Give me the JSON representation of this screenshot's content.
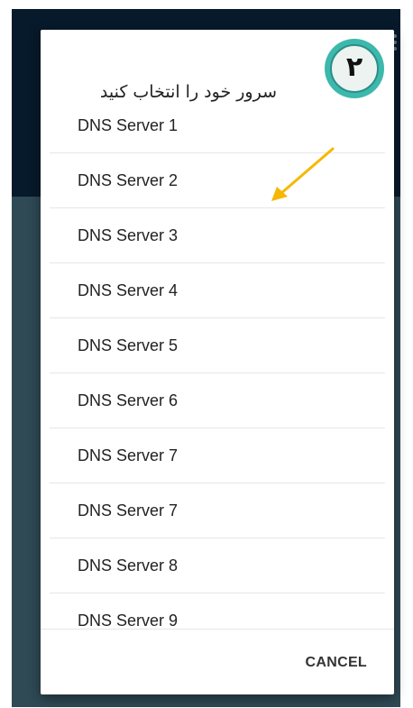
{
  "dialog": {
    "title": "سرور خود را انتخاب کنید",
    "step_badge": "٢",
    "cancel_label": "CANCEL"
  },
  "servers": [
    "DNS Server 1",
    "DNS Server 2",
    "DNS Server 3",
    "DNS Server 4",
    "DNS Server 5",
    "DNS Server 6",
    "DNS Server 7",
    "DNS Server 7",
    "DNS Server 8",
    "DNS Server 9"
  ],
  "colors": {
    "backdrop": "#2f4a55",
    "app_bar": "#071a2b",
    "badge": "#3db8ac",
    "arrow": "#f5b800"
  },
  "icons": {
    "overflow": "overflow-menu-icon",
    "annotation": "arrow-annotation-icon"
  }
}
